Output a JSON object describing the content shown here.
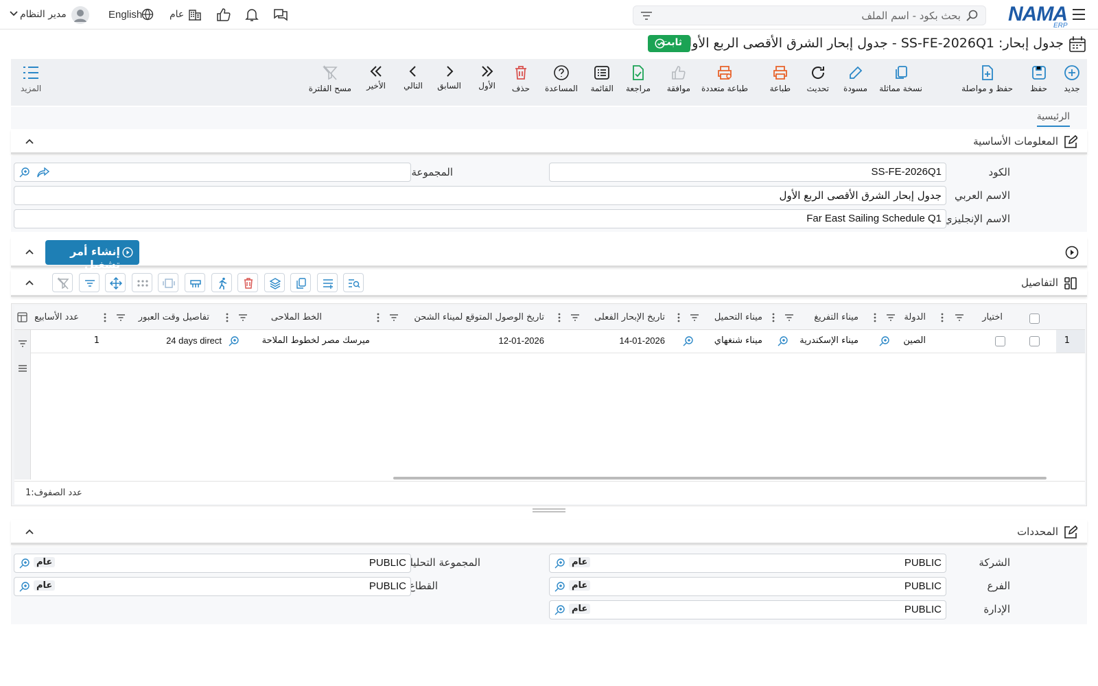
{
  "topbar": {
    "search_placeholder": "بحث بكود - اسم الملف",
    "logo": "NAMA",
    "logo_sub": "ERP",
    "user": "مدير النظام",
    "language": "English",
    "scope": "عام"
  },
  "title": {
    "text": "جدول إبحار: SS-FE-2026Q1 - جدول إبحار الشرق الأقصى الربع الأول",
    "status": "ثابت"
  },
  "toolbar": {
    "new": "جديد",
    "save": "حفظ",
    "save_continue": "حفظ و مواصلة",
    "duplicate": "نسخة مماثلة",
    "draft": "مسودة",
    "refresh": "تحديث",
    "print": "طباعة",
    "multi_print": "طباعة متعددة",
    "approve": "موافقة",
    "review": "مراجعة",
    "list": "القائمة",
    "help": "المساعدة",
    "delete": "حذف",
    "first": "الأول",
    "previous": "السابق",
    "next": "التالي",
    "last": "الأخير",
    "clear_filter": "مسح الفلترة",
    "more": "المزيد"
  },
  "tabs": [
    "الرئيسية"
  ],
  "basic": {
    "title": "المعلومات الأساسية",
    "code_label": "الكود",
    "code_value": "SS-FE-2026Q1",
    "group_label": "المجموعة",
    "group_value": "",
    "arabic_name_label": "الاسم العربي",
    "arabic_name_value": "جدول إبحار الشرق الأقصى الربع الأول",
    "english_name_label": "الاسم الإنجليزي",
    "english_name_value": "Far East Sailing Schedule Q1"
  },
  "actions": {
    "create_run_order": "إنشاء أمر تشغيل"
  },
  "details": {
    "title": "التفاصيل",
    "columns": [
      "اختيار",
      "الدولة",
      "ميناء التفريغ",
      "ميناء التحميل",
      "تاريخ الإبحار الفعلى",
      "تاريخ الوصول المتوقع لميناء الشحن",
      "الخط الملاحى",
      "تفاصيل وقت العبور",
      "عدد الأسابيع"
    ],
    "rows": [
      {
        "num": "1",
        "country": "الصين",
        "discharge_port": "ميناء الإسكندرية",
        "loading_port": "ميناء شنغهاي",
        "actual_sailing_date": "14-01-2026",
        "expected_arrival_date": "12-01-2026",
        "shipping_line": "ميرسك مصر لخطوط الملاحة",
        "transit_details": "24 days direct",
        "weeks": "1"
      }
    ],
    "row_count_label": "عدد الصفوف:",
    "row_count": "1"
  },
  "dimensions": {
    "title": "المحددات",
    "company_label": "الشركة",
    "company_value": "PUBLIC",
    "company_badge": "عام",
    "branch_label": "الفرع",
    "branch_value": "PUBLIC",
    "branch_badge": "عام",
    "department_label": "الإدارة",
    "department_value": "PUBLIC",
    "department_badge": "عام",
    "analytic_label": "المجموعة التحليلية",
    "analytic_value": "PUBLIC",
    "analytic_badge": "عام",
    "sector_label": "القطاع",
    "sector_value": "PUBLIC",
    "sector_badge": "عام"
  },
  "colors": {
    "accent": "#2a87c7",
    "status_green": "#1ba354",
    "run_button": "#1e7fb5",
    "delete_red": "#d9534f",
    "print_orange": "#e8622a"
  }
}
